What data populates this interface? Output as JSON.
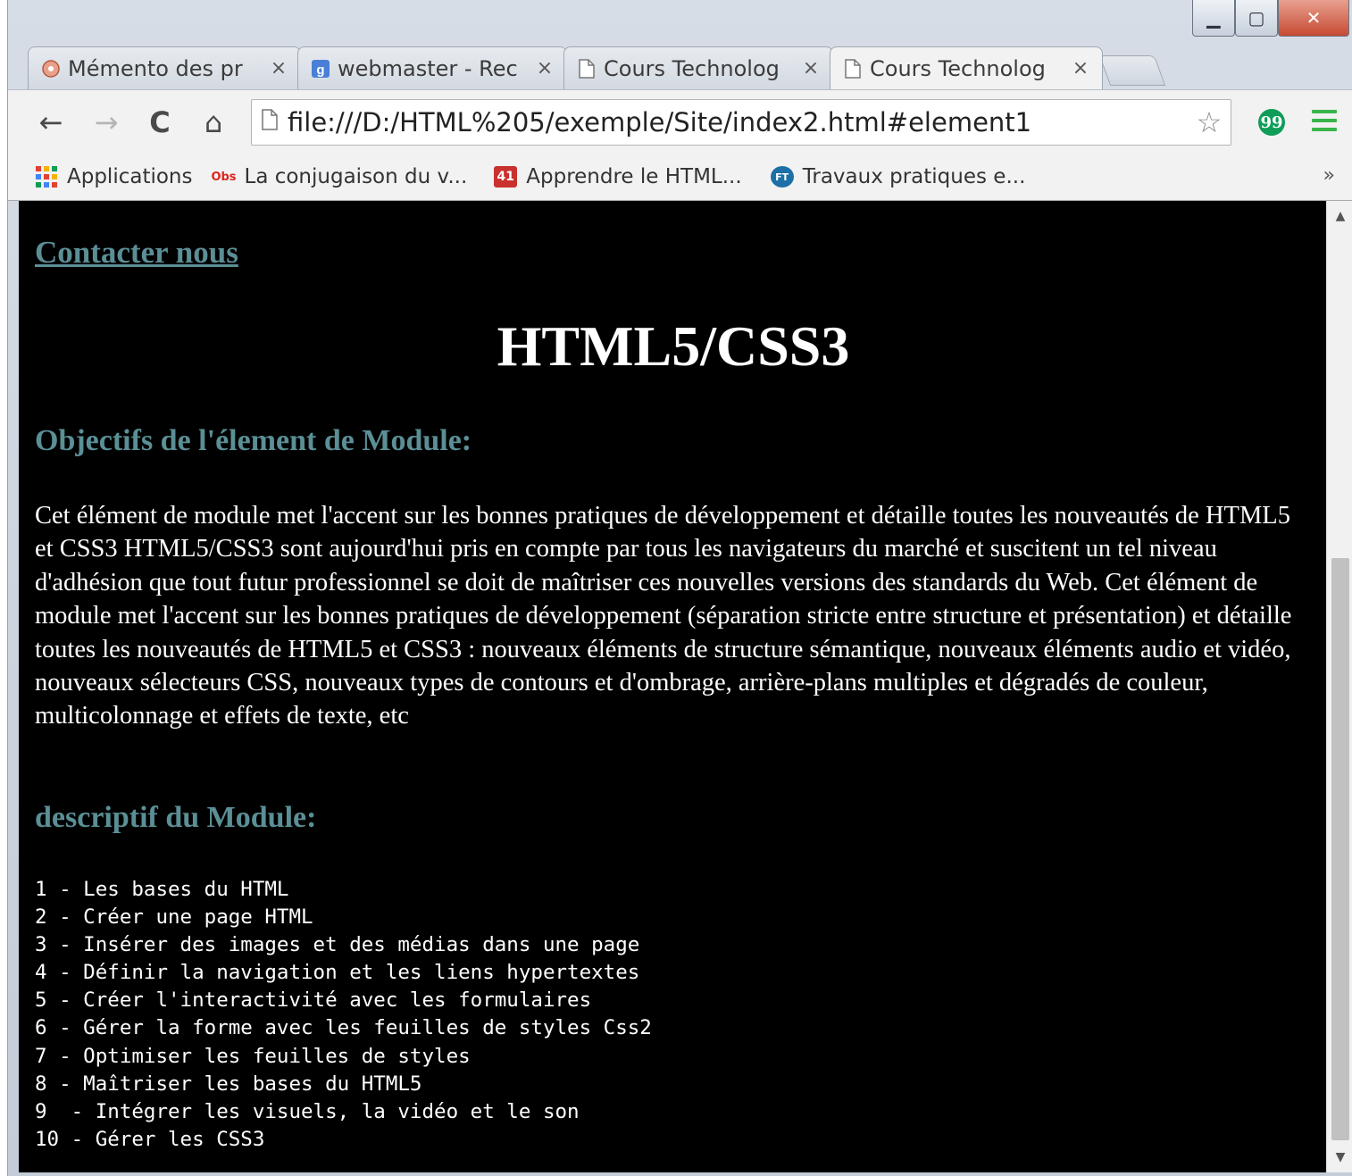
{
  "tabs": [
    {
      "title": "Mémento des pr",
      "icon": "puzzle-favicon-icon"
    },
    {
      "title": "webmaster - Rec",
      "icon": "google-g-favicon-icon"
    },
    {
      "title": "Cours Technolog",
      "icon": "page-icon"
    },
    {
      "title": "Cours Technolog",
      "icon": "page-icon",
      "active": true
    }
  ],
  "tab_close": "×",
  "window_controls": {
    "minimize": "▁",
    "maximize": "▢",
    "close": "✕"
  },
  "toolbar": {
    "back": "←",
    "forward": "→",
    "reload": "C",
    "home": "⌂",
    "url": "file:///D:/HTML%205/exemple/Site/index2.html#element1",
    "star": "☆",
    "extension": "99"
  },
  "bookmarks": [
    {
      "label": "Applications",
      "icon": "apps-grid-icon"
    },
    {
      "label": "La conjugaison du v...",
      "icon": "obs-favicon-icon",
      "icon_text": "Obs"
    },
    {
      "label": "Apprendre le HTML...",
      "icon": "41-favicon-icon",
      "icon_text": "41"
    },
    {
      "label": "Travaux pratiques e...",
      "icon": "ft-favicon-icon",
      "icon_text": "FT"
    }
  ],
  "bookmarks_overflow": "»",
  "page": {
    "contact_link": "Contacter nous",
    "title": "HTML5/CSS3",
    "objectives_heading": "Objectifs de l'élement de Module:",
    "objectives_text": "Cet élément de module met l'accent sur les bonnes pratiques de développement et détaille toutes les nouveautés de HTML5 et CSS3 HTML5/CSS3 sont aujourd'hui pris en compte par tous les navigateurs du marché et suscitent un tel niveau d'adhésion que tout futur professionnel se doit de maîtriser ces nouvelles versions des standards du Web. Cet élément de module met l'accent sur les bonnes pratiques de développement (séparation stricte entre structure et présentation) et détaille toutes les nouveautés de HTML5 et CSS3 : nouveaux éléments de structure sémantique, nouveaux éléments audio et vidéo, nouveaux sélecteurs CSS, nouveaux types de contours et d'ombrage, arrière-plans multiples et dégradés de couleur, multicolonnage et effets de texte, etc",
    "description_heading": "descriptif du Module:",
    "modules": [
      "1 - Les bases du HTML",
      "2 - Créer une page HTML",
      "3 - Insérer des images et des médias dans une page",
      "4 - Définir la navigation et les liens hypertextes",
      "5 - Créer l'interactivité avec les formulaires",
      "6 - Gérer la forme avec les feuilles de styles Css2",
      "7 - Optimiser les feuilles de styles",
      "8 - Maîtriser les bases du HTML5",
      "9  - Intégrer les visuels, la vidéo et le son",
      "10 - Gérer les CSS3"
    ]
  },
  "colors": {
    "page_background": "#000000",
    "heading_teal": "#5b8f96",
    "text": "#ffffff",
    "hangouts_green": "#0f9d58",
    "menu_green": "#39b54a"
  }
}
